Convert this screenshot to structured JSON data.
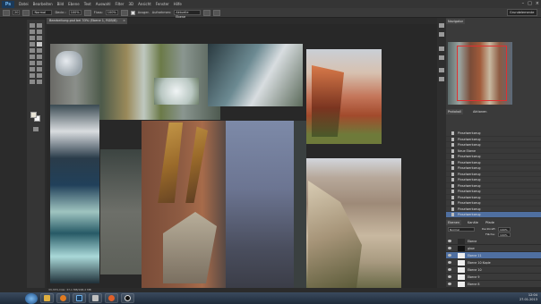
{
  "app": {
    "logo": "Ps"
  },
  "menu": [
    "Datei",
    "Bearbeiten",
    "Bild",
    "Ebene",
    "Text",
    "Auswahl",
    "Filter",
    "3D",
    "Ansicht",
    "Fenster",
    "Hilfe"
  ],
  "window_controls": [
    "–",
    "□",
    "×"
  ],
  "options": {
    "brush_size": "20",
    "mode": "Normal",
    "opacity_label": "Deckr.:",
    "opacity": "100%",
    "flow_label": "Fluss:",
    "flow": "100%",
    "align_label": "Ausger.",
    "sample_label": "Aufnehmen:",
    "sample_value": "Aktuelle Ebene",
    "workspace": "Grundelemente"
  },
  "document": {
    "tab_title": "Bearbeitung.psd bei 33% (Ebene 1, RGB/8)",
    "close": "×"
  },
  "status": {
    "text": "33,33%  Dok: 37,1 MB/168,2 MB"
  },
  "navigator": {
    "tab": "Navigator"
  },
  "history": {
    "tabs": [
      "Protokoll",
      "Aktionen"
    ],
    "items": [
      "Pinselwerkzeug",
      "Pinselwerkzeug",
      "Pinselwerkzeug",
      "Neue Ebene",
      "Pinselwerkzeug",
      "Pinselwerkzeug",
      "Pinselwerkzeug",
      "Pinselwerkzeug",
      "Pinselwerkzeug",
      "Pinselwerkzeug",
      "Pinselwerkzeug",
      "Pinselwerkzeug",
      "Pinselwerkzeug",
      "Pinselwerkzeug",
      "Pinselwerkzeug"
    ]
  },
  "layers": {
    "tabs": [
      "Ebenen",
      "Kanäle",
      "Pfade"
    ],
    "blend": "Normal",
    "opacity_label": "Deckkraft:",
    "opacity": "100%",
    "fill_label": "Fläche:",
    "fill": "100%",
    "items": [
      "Ebene",
      "glow",
      "Ebene 11",
      "Ebene 10 Kopie",
      "Ebene 10",
      "Ebene 9",
      "Ebene 8"
    ]
  },
  "taskbar": {
    "time": "12:04",
    "date": "27.01.2013"
  },
  "colors": {
    "selection": "#4f6fa0",
    "panel_bg": "#3a3a3a",
    "canvas_bg": "#282828"
  }
}
